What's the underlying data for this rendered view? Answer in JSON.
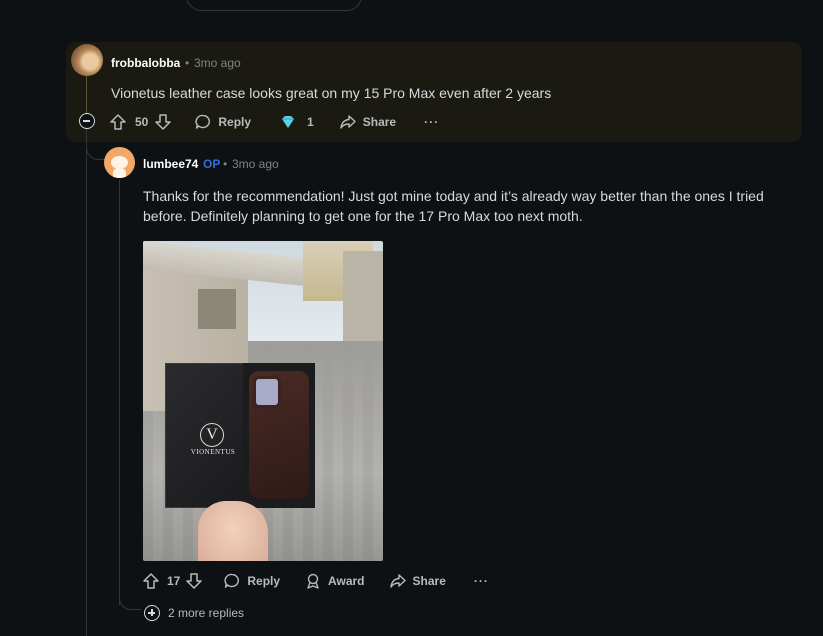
{
  "comment_1": {
    "username": "frobbalobba",
    "time": "3mo ago",
    "body": "Vionetus leather case looks great on my 15 Pro Max even after 2 years",
    "votes": "50",
    "reply_label": "Reply",
    "award_count": "1",
    "share_label": "Share",
    "more_label": "···"
  },
  "comment_2": {
    "username": "lumbee74",
    "op_badge": "OP",
    "time": "3mo ago",
    "body_line_1": "Thanks for the recommendation! Just got mine today and it’s already way better than the ones I tried",
    "body_line_2": "before. Definitely planning to get one for the 17 Pro Max too next moth.",
    "photo_brand_letter": "V",
    "photo_brand_text": "VIONENTUS",
    "votes": "17",
    "reply_label": "Reply",
    "award_label": "Award",
    "share_label": "Share",
    "more_label": "···"
  },
  "thread": {
    "more_replies": "2 more replies"
  },
  "meta_separator": "•"
}
